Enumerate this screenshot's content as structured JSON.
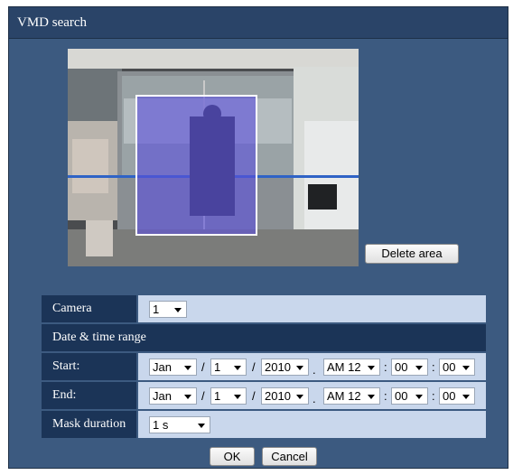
{
  "dialog": {
    "title": "VMD search"
  },
  "preview": {
    "delete_area_label": "Delete area"
  },
  "form": {
    "camera": {
      "label": "Camera",
      "value": "1"
    },
    "date_time_range": {
      "label": "Date & time range"
    },
    "start": {
      "label": "Start:",
      "month": "Jan",
      "day": "1",
      "year": "2010",
      "hour": "AM 12",
      "minute": "00",
      "second": "00"
    },
    "end": {
      "label": "End:",
      "month": "Jan",
      "day": "1",
      "year": "2010",
      "hour": "AM 12",
      "minute": "00",
      "second": "00"
    },
    "mask_duration": {
      "label": "Mask duration",
      "value": "1 s"
    },
    "separators": {
      "date": "/",
      "dot": ".",
      "time": ":"
    }
  },
  "footer": {
    "ok_label": "OK",
    "cancel_label": "Cancel"
  },
  "colors": {
    "dialog_bg": "#3c5a80",
    "title_bg": "#2a4468",
    "label_bg": "#1b3457",
    "value_bg": "#c9d7ec",
    "vmd_area_fill": "#5c50dc"
  }
}
